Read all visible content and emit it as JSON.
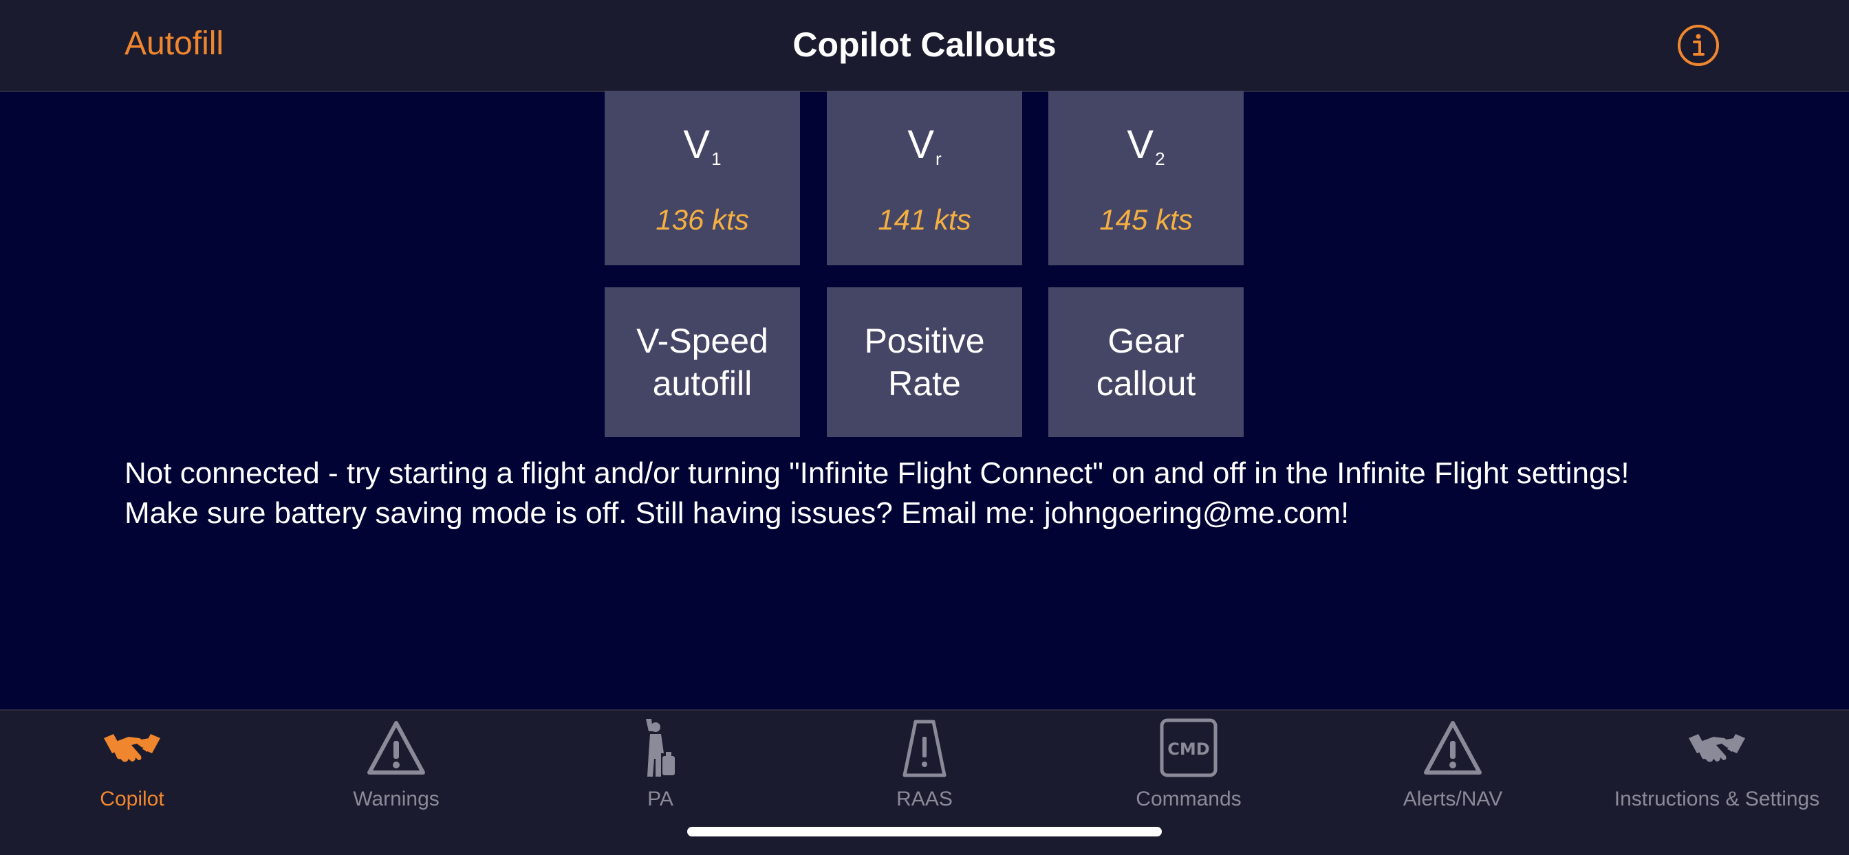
{
  "header": {
    "left_button": "Autofill",
    "title": "Copilot Callouts",
    "info_icon": "info-circle-icon"
  },
  "speeds": [
    {
      "symbol": "V",
      "subscript": "1",
      "value": "136 kts"
    },
    {
      "symbol": "V",
      "subscript": "r",
      "value": "141 kts"
    },
    {
      "symbol": "V",
      "subscript": "2",
      "value": "145 kts"
    }
  ],
  "actions": [
    {
      "label": "V-Speed\nautofill"
    },
    {
      "label": "Positive\nRate"
    },
    {
      "label": "Gear\ncallout"
    }
  ],
  "status": {
    "line1": "Not connected - try starting a flight and/or turning \"Infinite Flight Connect\" on and off in the Infinite Flight settings!",
    "line2": "Make sure battery saving mode is off. Still having issues? Email me: johngoering@me.com!"
  },
  "tabs": [
    {
      "label": "Copilot",
      "icon": "handshake-icon",
      "active": true
    },
    {
      "label": "Warnings",
      "icon": "warning-triangle-icon",
      "active": false
    },
    {
      "label": "PA",
      "icon": "passenger-icon",
      "active": false
    },
    {
      "label": "RAAS",
      "icon": "runway-icon",
      "active": false
    },
    {
      "label": "Commands",
      "icon": "cmd-icon",
      "active": false
    },
    {
      "label": "Alerts/NAV",
      "icon": "alert-triangle-icon",
      "active": false
    },
    {
      "label": "Instructions & Settings",
      "icon": "handshake-icon",
      "active": false
    }
  ],
  "colors": {
    "accent": "#f0872e",
    "speed_value": "#f5b041",
    "background": "#000333",
    "bar": "#1a1b2e",
    "tile": "#454566",
    "inactive": "#8a8a99"
  }
}
